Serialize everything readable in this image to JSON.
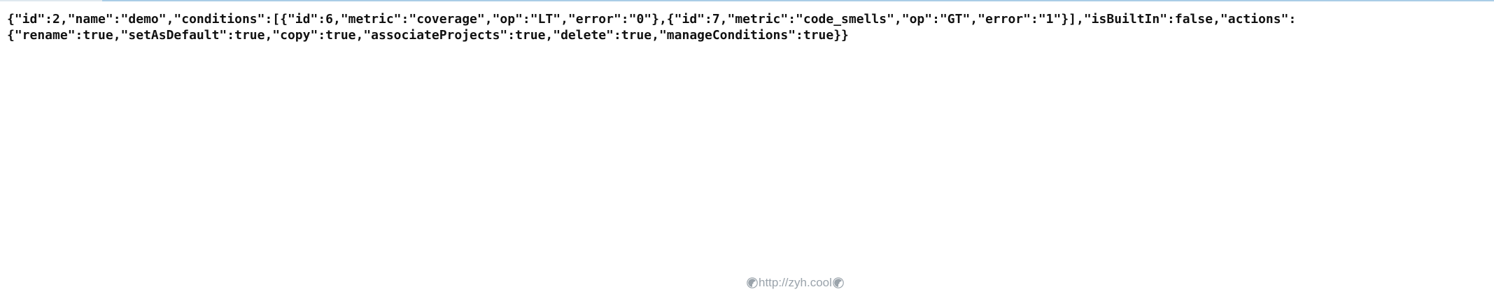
{
  "document": {
    "raw_text": "{\"id\":2,\"name\":\"demo\",\"conditions\":[{\"id\":6,\"metric\":\"coverage\",\"op\":\"LT\",\"error\":\"0\"},{\"id\":7,\"metric\":\"code_smells\",\"op\":\"GT\",\"error\":\"1\"}],\"isBuiltIn\":false,\"actions\":\n{\"rename\":true,\"setAsDefault\":true,\"copy\":true,\"associateProjects\":true,\"delete\":true,\"manageConditions\":true}}"
  },
  "watermark": {
    "text": "http://zyh.cool",
    "left_icon": "radiation-icon",
    "right_icon": "radiation-icon"
  },
  "colors": {
    "text": "#111111",
    "watermark": "#9aa3ab",
    "top_border": "#a9cde6"
  }
}
